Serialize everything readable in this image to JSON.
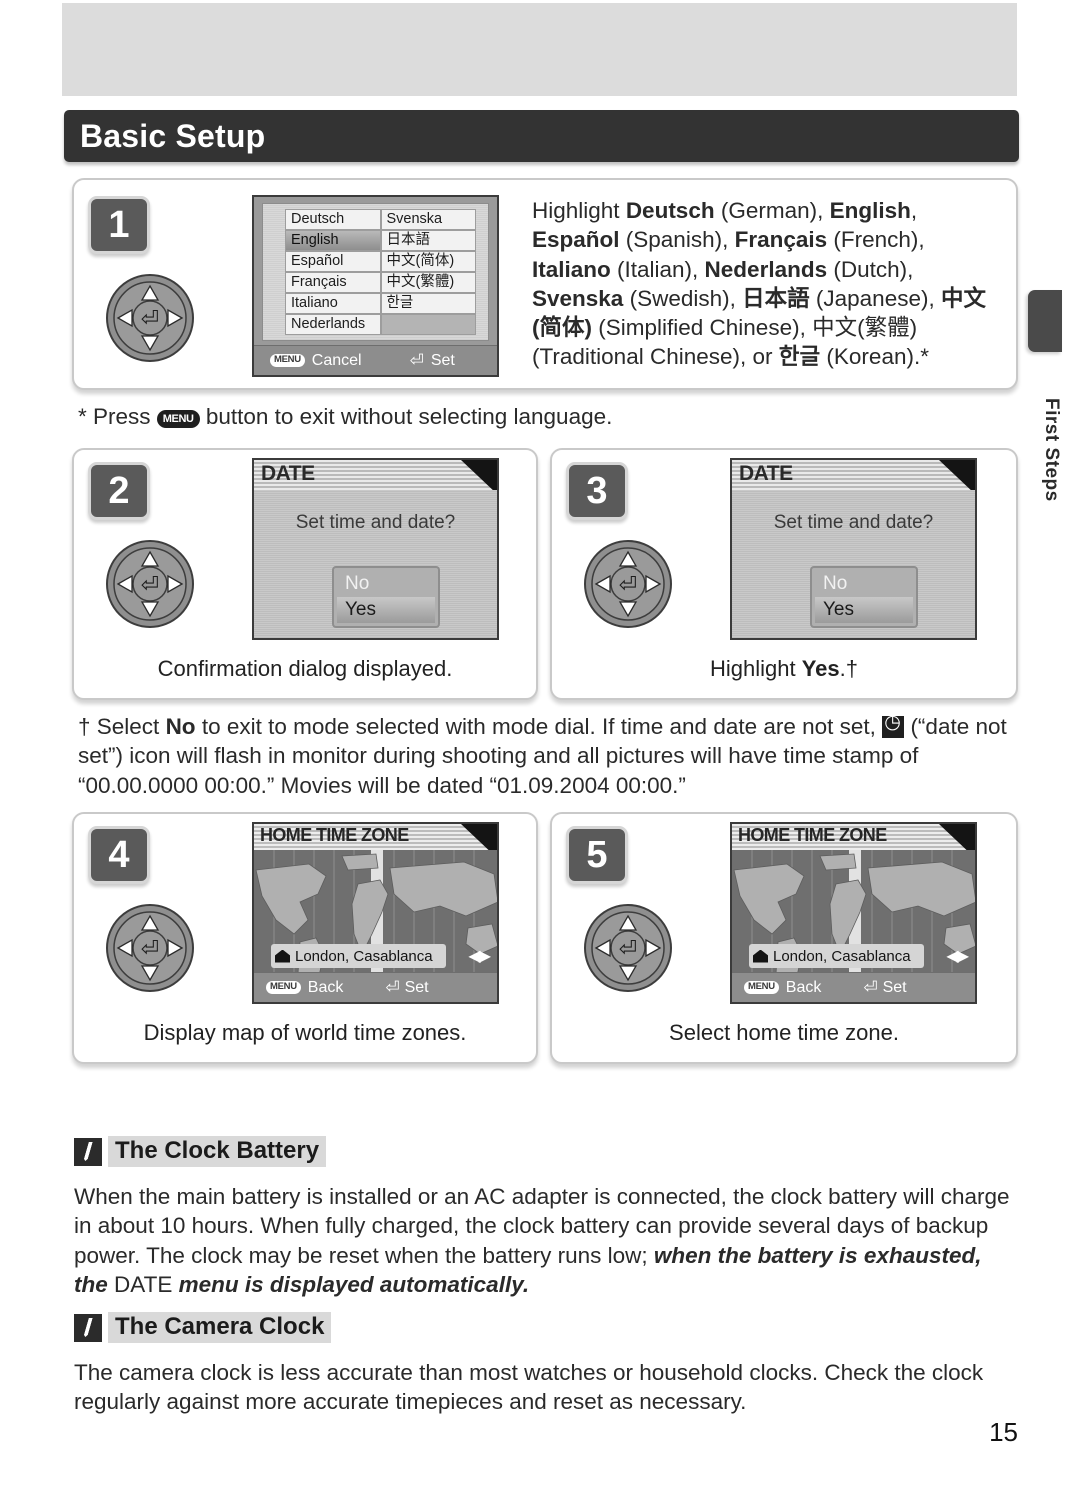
{
  "document": {
    "title": "Basic Setup",
    "page_number": "15",
    "side_tab_label": "First Steps"
  },
  "steps": [
    {
      "number": "1",
      "screen": {
        "type": "language-select",
        "languages_left": [
          "Deutsch",
          "English",
          "Español",
          "Français",
          "Italiano",
          "Nederlands"
        ],
        "languages_right": [
          "Svenska",
          "日本語",
          "中文(简体)",
          "中文(繁體)",
          "한글",
          ""
        ],
        "selected": "English",
        "cancel_label": "Cancel",
        "set_label": "Set",
        "menu_button_label": "MENU",
        "enter_glyph": "⏎"
      },
      "instruction_html": "Highlight <b>Deutsch</b> (German), <b>English</b>, <b>Español</b> (Spanish), <b>Français</b> (French), <b>Italiano</b> (Italian), <b>Nederlands</b> (Dutch), <b>Svenska</b> (Swedish), <b>日本語</b> (Japanese), <b>中文(简体)</b> (Simplified Chinese), 中文(繁體) (Traditional Chinese), or <b>한글</b> (Korean).*"
    },
    {
      "number": "2",
      "screen": {
        "type": "date-confirm",
        "title": "DATE",
        "question": "Set time and date?",
        "options": [
          "No",
          "Yes"
        ],
        "selected": "Yes"
      },
      "caption": "Confirmation dialog displayed."
    },
    {
      "number": "3",
      "screen": {
        "type": "date-confirm",
        "title": "DATE",
        "question": "Set time and date?",
        "options": [
          "No",
          "Yes"
        ],
        "selected": "Yes"
      },
      "caption_html": "Highlight <b>Yes</b>.†"
    },
    {
      "number": "4",
      "screen": {
        "type": "home-time-zone",
        "title": "HOME TIME ZONE",
        "city": "London, Casablanca",
        "back_label": "Back",
        "set_label": "Set",
        "menu_button_label": "MENU"
      },
      "caption": "Display map of world time zones."
    },
    {
      "number": "5",
      "screen": {
        "type": "home-time-zone",
        "title": "HOME TIME ZONE",
        "city": "London, Casablanca",
        "back_label": "Back",
        "set_label": "Set",
        "menu_button_label": "MENU"
      },
      "caption": "Select home time zone."
    }
  ],
  "footnotes": {
    "asterisk_html": "* Press <span class=\"menu-inline\">MENU</span> button to exit without selecting language.",
    "dagger_html": "† Select <b>No</b> to exit to mode selected with mode dial.  If time and date are not set, <span class=\"clock-inline\"></span> (“date not set”) icon will flash in monitor during shooting and all pictures will have time stamp of  “00.00.0000 00:00.”  Movies will be dated “01.09.2004 00:00.”"
  },
  "notes": [
    {
      "title": "The Clock Battery",
      "body_html": "When the main battery is installed or an AC adapter is connected, the clock battery will charge in about 10 hours.  When fully charged, the clock battery can provide several days of backup power.  The clock may be reset when the battery runs low; <i>when the battery is exhausted, the</i> DATE <i>menu is displayed automatically.</i>"
    },
    {
      "title": "The Camera Clock",
      "body_html": "The camera clock is less accurate than most watches or household clocks.  Check the clock regularly against more accurate timepieces and reset as necessary."
    }
  ],
  "colors": {
    "title_bar": "#333333",
    "top_band": "#dcdcdc",
    "badge": "#5a5a5a",
    "note_highlight": "#d9d9d9"
  }
}
